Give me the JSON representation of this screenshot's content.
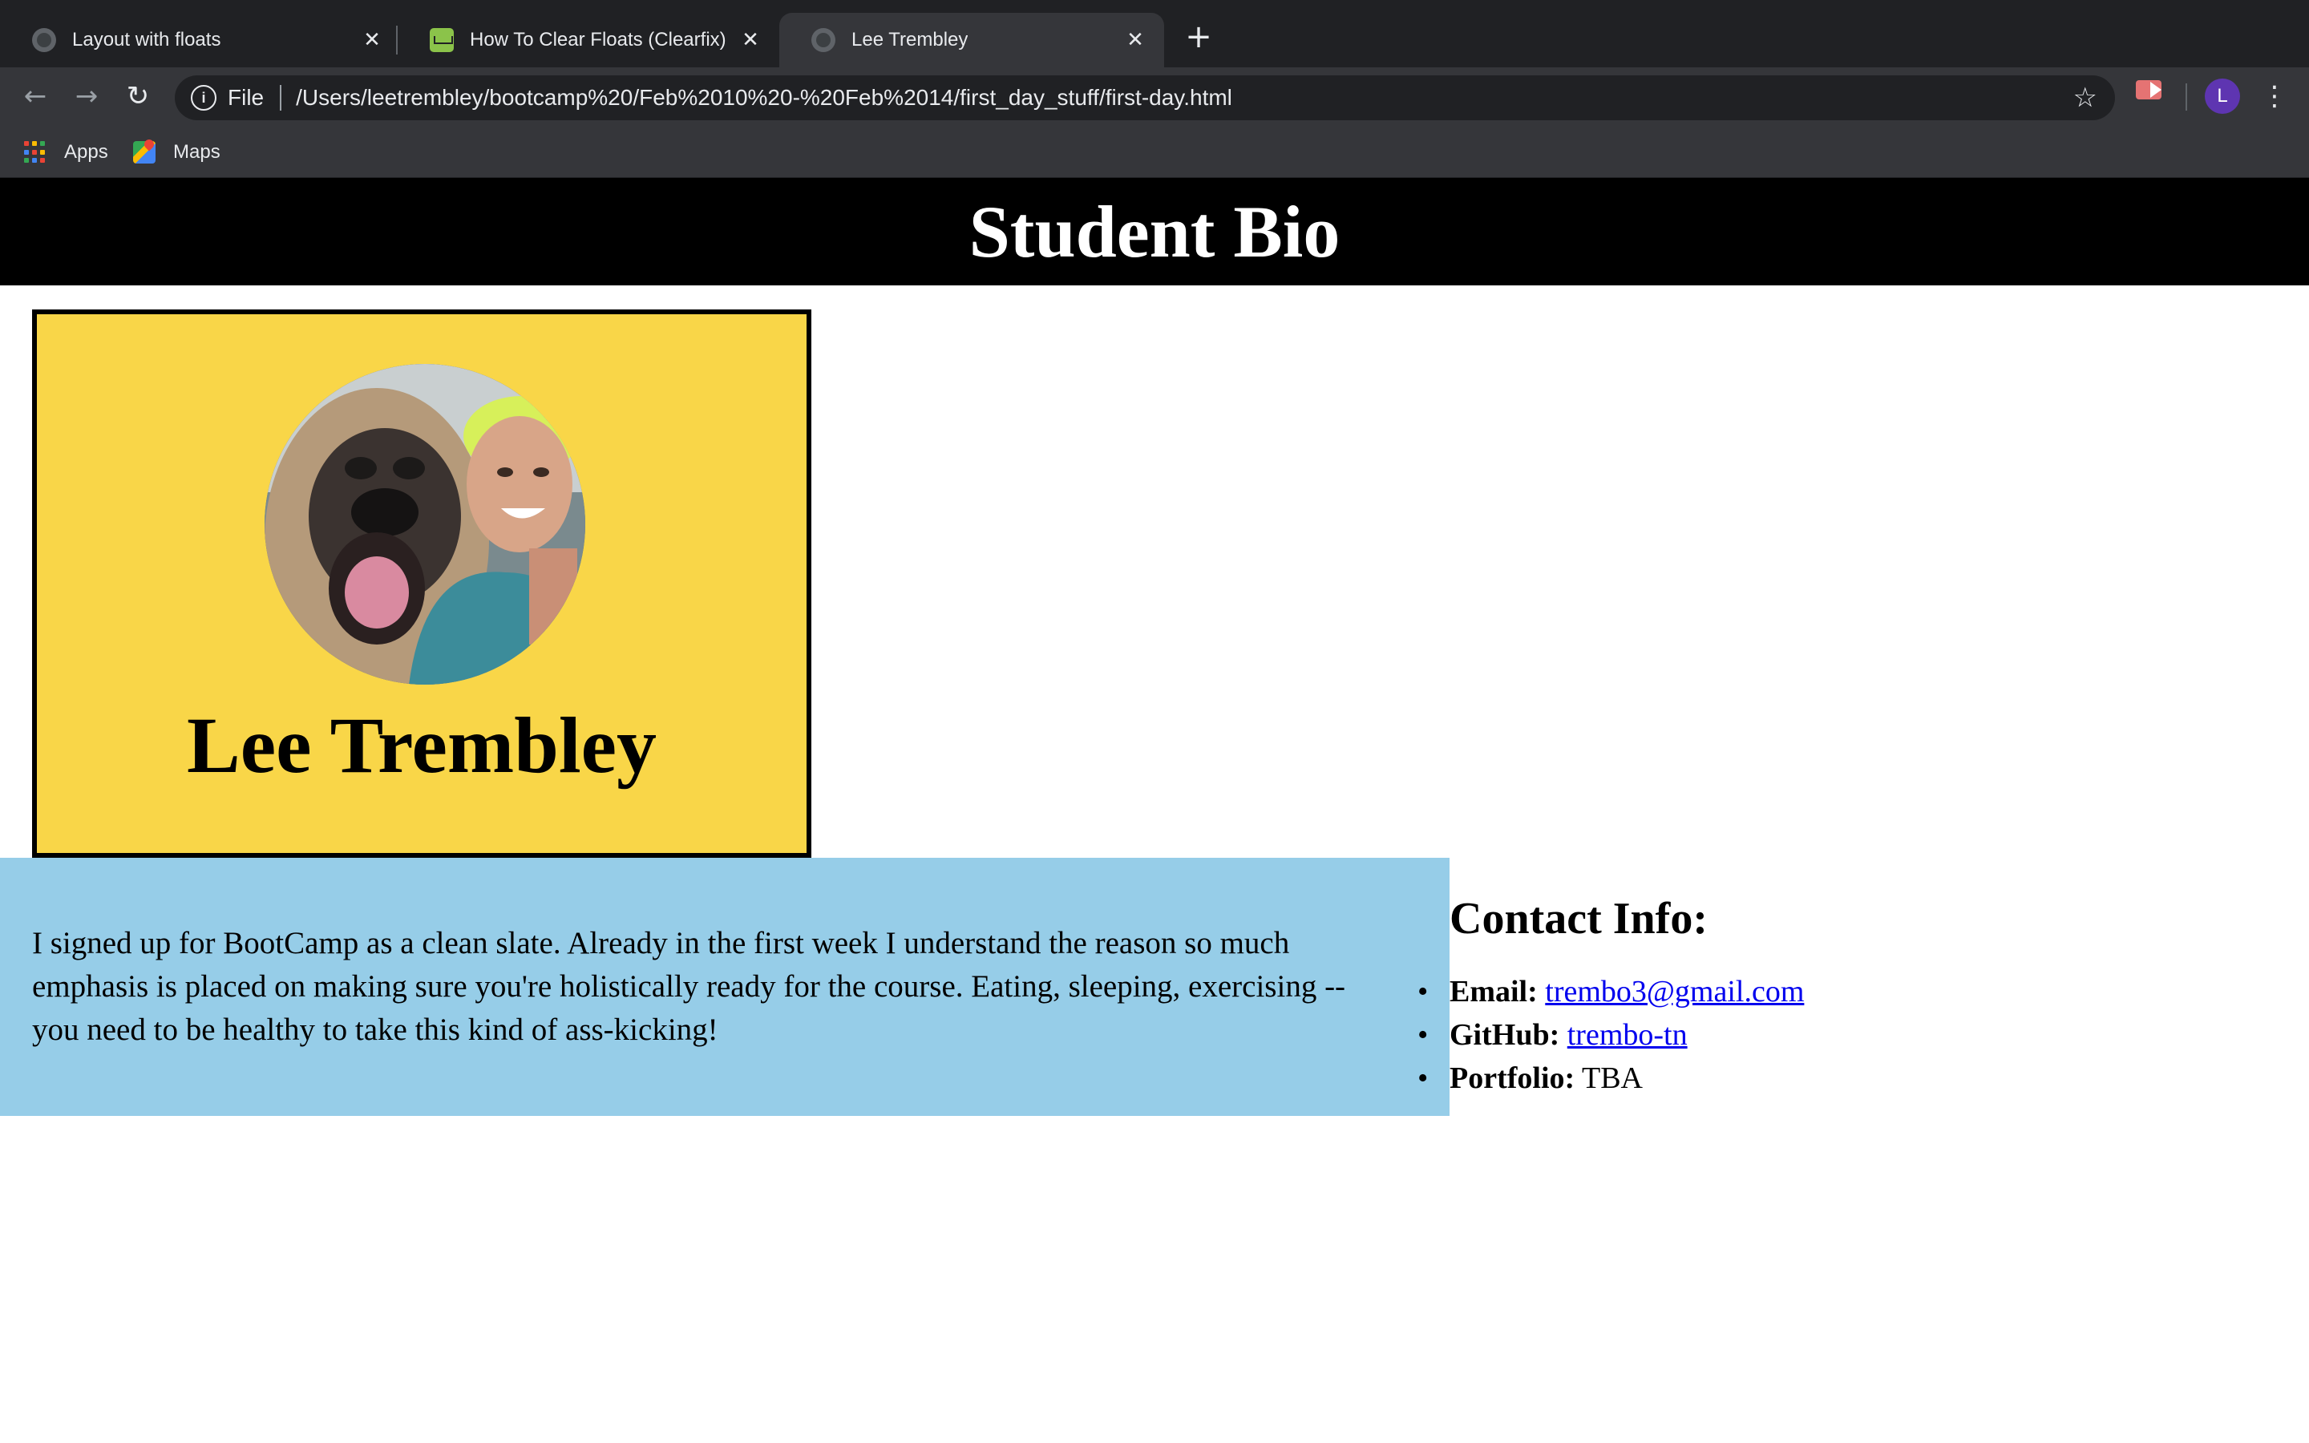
{
  "browser": {
    "tabs": [
      {
        "title": "Layout with floats",
        "active": false,
        "favicon": "globe-icon"
      },
      {
        "title": "How To Clear Floats (Clearfix)",
        "active": false,
        "favicon": "w3schools-icon"
      },
      {
        "title": "Lee Trembley",
        "active": true,
        "favicon": "globe-icon"
      }
    ],
    "new_tab_label": "+",
    "close_glyph": "✕",
    "address": {
      "scheme_label": "File",
      "url": "/Users/leetrembley/bootcamp%20/Feb%2010%20-%20Feb%2014/first_day_stuff/first-day.html"
    },
    "profile_initial": "L",
    "bookmarks": [
      {
        "label": "Apps",
        "icon": "apps-grid-icon"
      },
      {
        "label": "Maps",
        "icon": "maps-icon"
      }
    ],
    "colors": {
      "frame": "#202124",
      "toolbar": "#35363a",
      "text": "#e8eaed",
      "avatar": "#5e35b1"
    }
  },
  "page": {
    "header_title": "Student Bio",
    "profile": {
      "name": "Lee Trembley",
      "photo_alt": "Lee Trembley with his dog"
    },
    "bio_text": "I signed up for BootCamp as a clean slate. Already in the first week I understand the reason so much emphasis is placed on making sure you're holistically ready for the course. Eating, sleeping, exercising -- you need to be healthy to take this kind of ass-kicking!",
    "contact": {
      "heading": "Contact Info:",
      "items": [
        {
          "label": "Email:",
          "value": "trembo3@gmail.com",
          "is_link": true
        },
        {
          "label": "GitHub:",
          "value": "trembo-tn",
          "is_link": true
        },
        {
          "label": "Portfolio:",
          "value": "TBA",
          "is_link": false
        }
      ]
    },
    "colors": {
      "header_bg": "#000000",
      "card_bg": "#f9d648",
      "bio_bg": "#96cde8",
      "link": "#0000ee"
    }
  }
}
